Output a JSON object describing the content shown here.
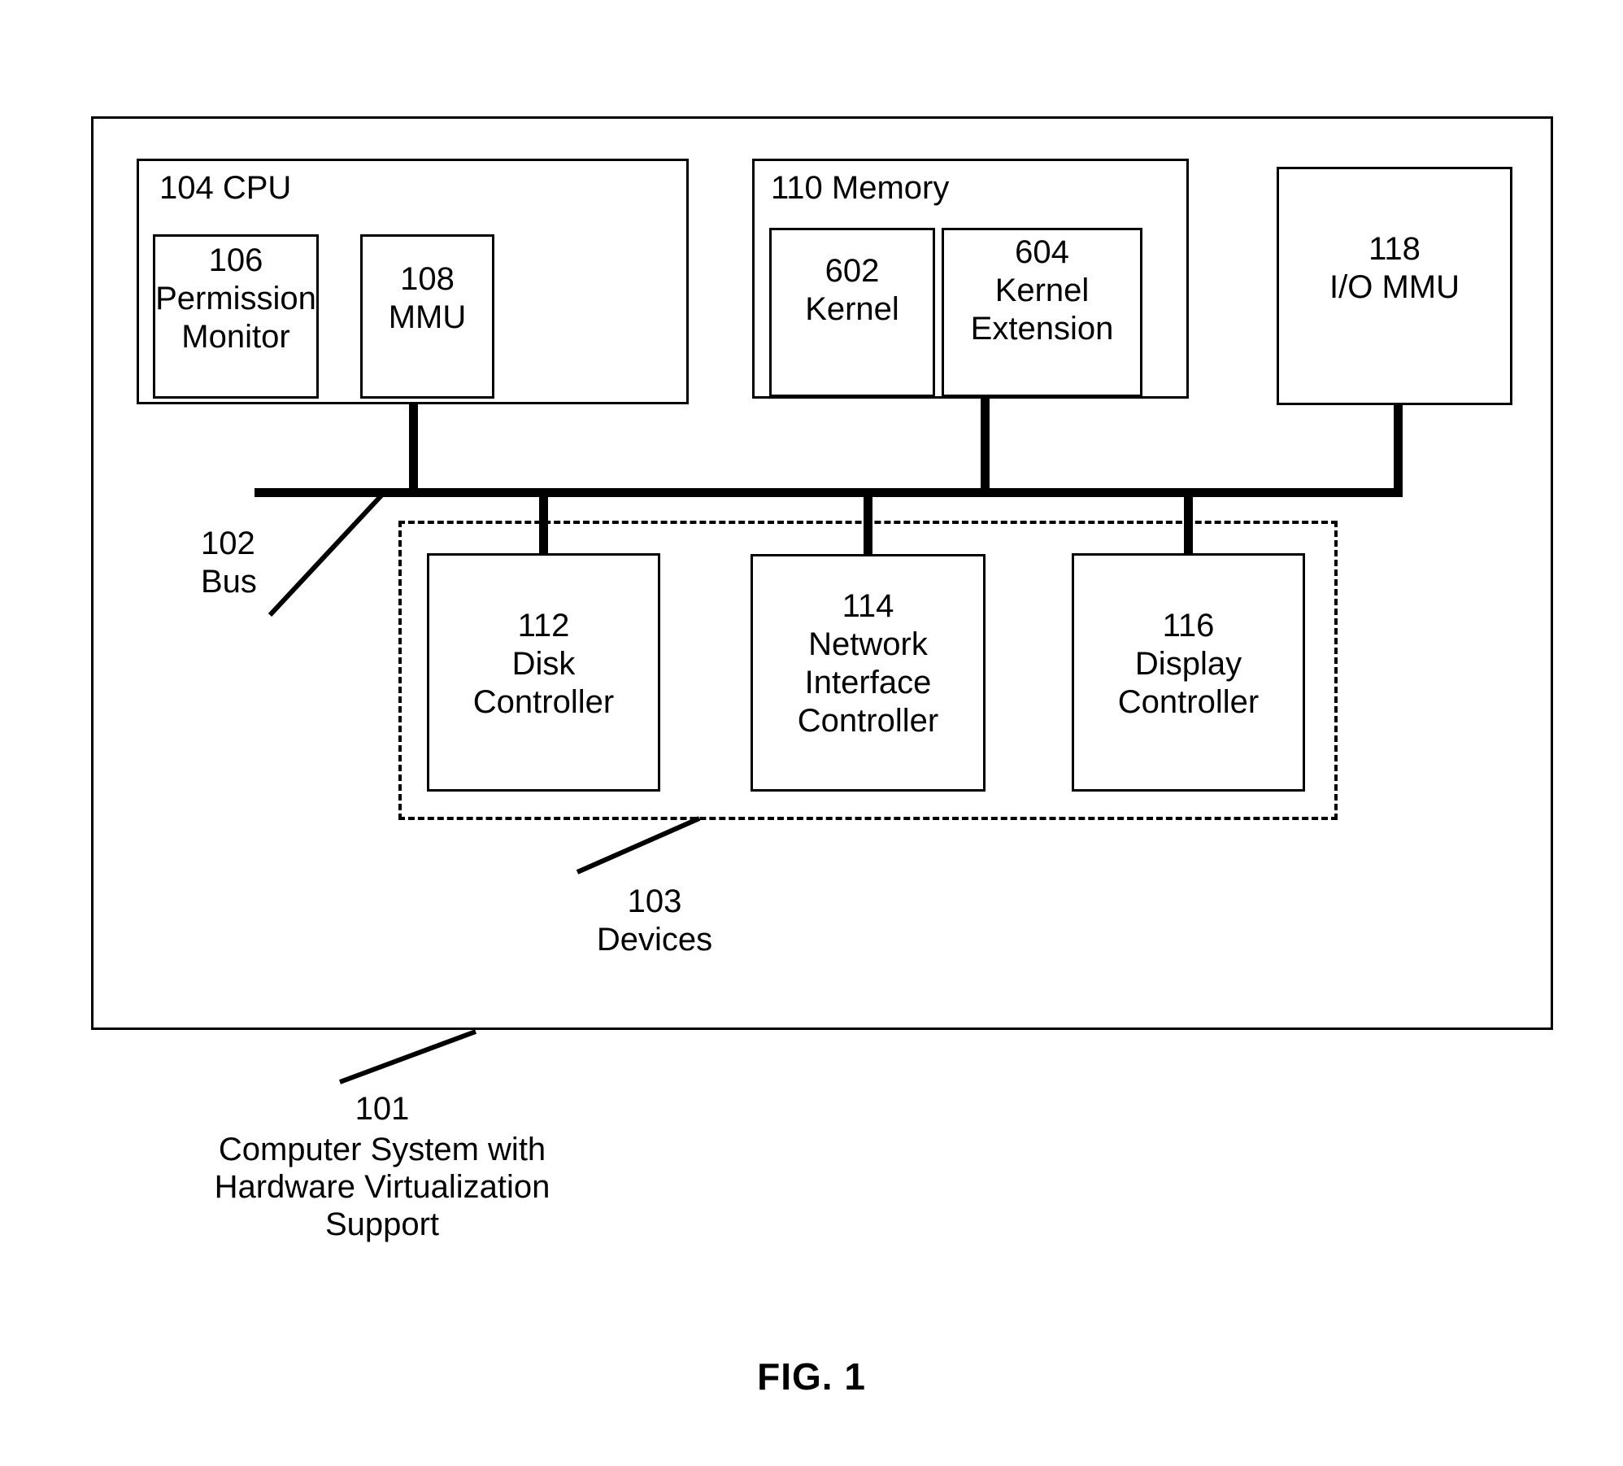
{
  "figure": {
    "caption": "FIG. 1",
    "outer_system": {
      "ref": "101",
      "name": "Computer System with\nHardware Virtualization\nSupport"
    },
    "bus": {
      "ref": "102",
      "name": "Bus"
    },
    "devices_group": {
      "ref": "103",
      "name": "Devices"
    },
    "cpu": {
      "header": "104 CPU",
      "children": [
        {
          "ref": "106",
          "name": "Permission\nMonitor"
        },
        {
          "ref": "108",
          "name": "MMU"
        }
      ]
    },
    "memory": {
      "header": "110 Memory",
      "children": [
        {
          "ref": "602",
          "name": "Kernel"
        },
        {
          "ref": "604",
          "name": "Kernel\nExtension"
        }
      ]
    },
    "iommu": {
      "ref": "118",
      "name": "I/O MMU"
    },
    "devices": [
      {
        "ref": "112",
        "name": "Disk\nController"
      },
      {
        "ref": "114",
        "name": "Network\nInterface\nController"
      },
      {
        "ref": "116",
        "name": "Display\nController"
      }
    ],
    "colors": {
      "line": "#000000",
      "background": "#ffffff"
    }
  }
}
